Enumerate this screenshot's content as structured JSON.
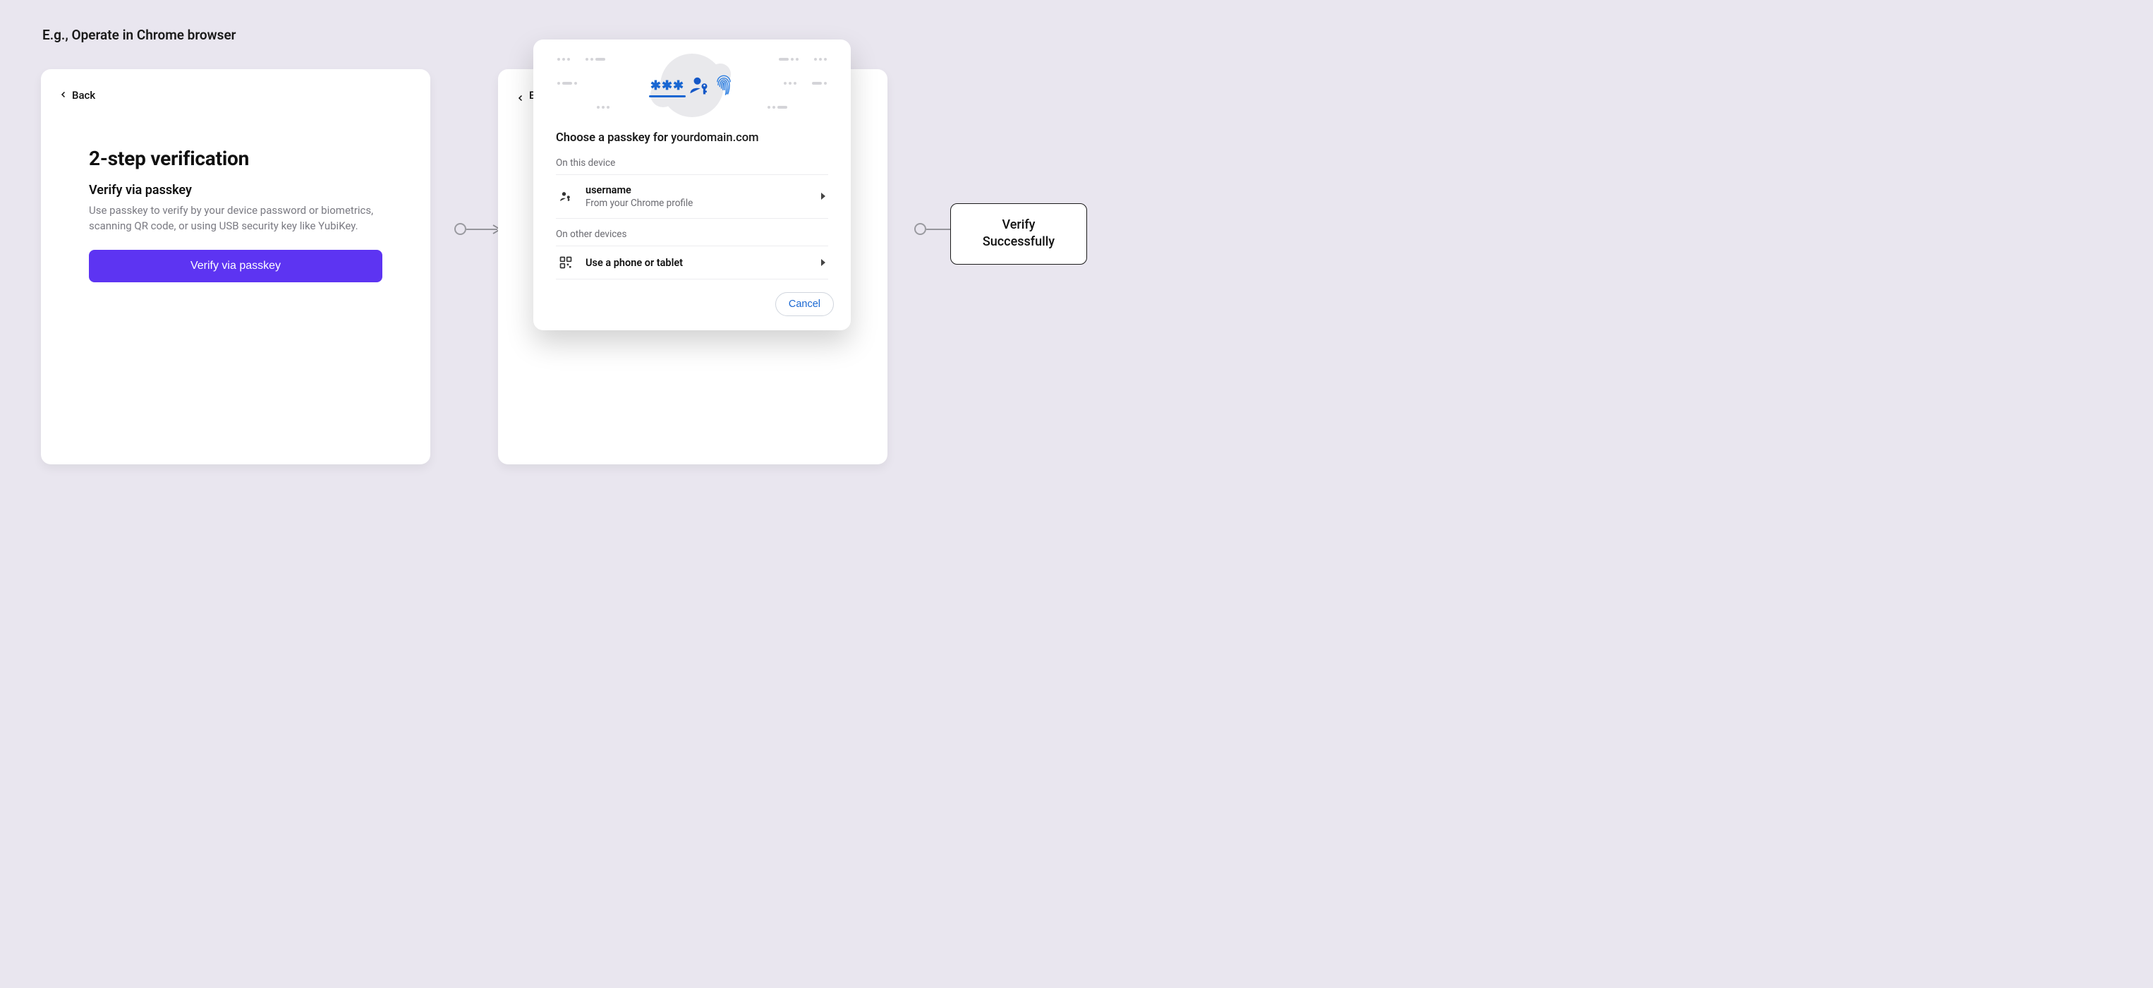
{
  "title": "E.g., Operate in Chrome browser",
  "flow": {
    "result_line1": "Verify",
    "result_line2": "Successfully"
  },
  "card1": {
    "back_label": "Back",
    "heading": "2-step verification",
    "sub_heading": "Verify via passkey",
    "description": "Use passkey to verify by your device password or biometrics, scanning QR code, or using USB security key like YubiKey.",
    "button_label": "Verify via passkey"
  },
  "card2": {
    "back_label": "B"
  },
  "dialog": {
    "asterisks": "✱✱✱",
    "title_prefix": "Choose a passkey for ",
    "title_domain": "yourdomain.com",
    "section_this_device": "On this device",
    "option1": {
      "title": "username",
      "subtitle": "From your Chrome profile"
    },
    "section_other": "On other devices",
    "option2": {
      "title": "Use a phone or tablet"
    },
    "cancel_label": "Cancel"
  }
}
